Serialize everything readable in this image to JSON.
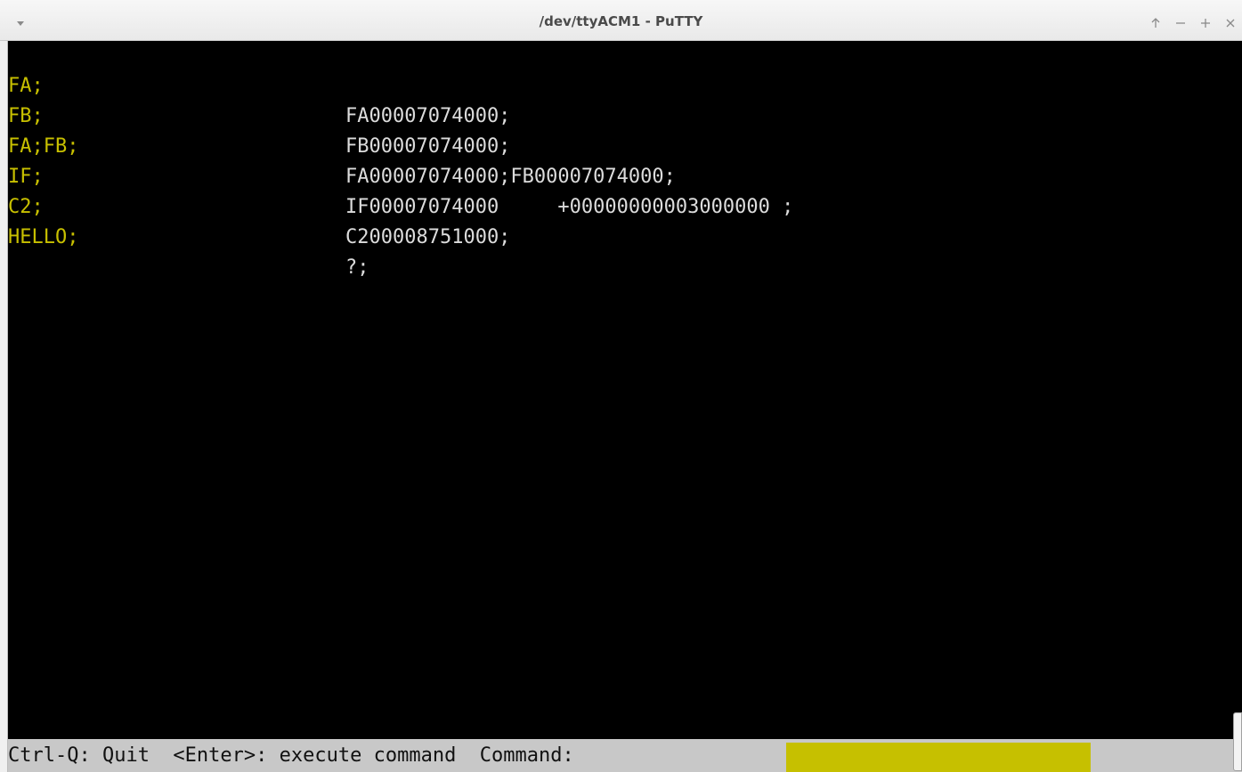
{
  "window": {
    "title": "/dev/ttyACM1 - PuTTY",
    "controls": [
      "arrow-up-icon",
      "minimize-icon",
      "maximize-icon",
      "close-icon"
    ]
  },
  "terminal": {
    "lines": [
      {
        "command": "FA;",
        "response": "FA00007074000;"
      },
      {
        "command": "FB;",
        "response": "FB00007074000;"
      },
      {
        "command": "FA;FB;",
        "response": "FA00007074000;FB00007074000;"
      },
      {
        "command": "IF;",
        "response": "IF00007074000     +00000000003000000 ;"
      },
      {
        "command": "C2;",
        "response": "C200008751000;"
      },
      {
        "command": "HELLO;",
        "response": "?;"
      }
    ],
    "colors": {
      "command": "#c8c000",
      "response": "#dcdcdc",
      "background": "#000000"
    }
  },
  "statusbar": {
    "hint": "Ctrl-Q: Quit  <Enter>: execute command  Command:",
    "input_value": "",
    "input_color": "#c6c000",
    "background": "#c8c8c8"
  }
}
